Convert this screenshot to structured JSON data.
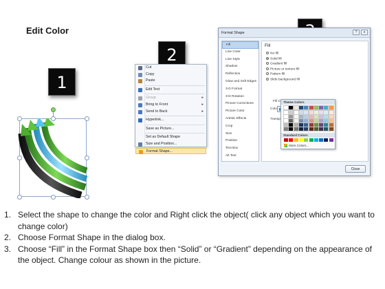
{
  "title": "Edit Color",
  "steps_badges": [
    "1",
    "2",
    "3"
  ],
  "context_menu": {
    "items": [
      {
        "label": "Cut",
        "icon": "scissors-icon",
        "color": "#5b6b86",
        "underline": "t",
        "disabled": false
      },
      {
        "label": "Copy",
        "icon": "copy-icon",
        "color": "#6f8bb3",
        "disabled": false
      },
      {
        "label": "Paste",
        "icon": "paste-icon",
        "color": "#b5853a",
        "disabled": false
      },
      {
        "sep": true
      },
      {
        "label": "Edit Text",
        "icon": "edit-text-icon",
        "color": "#3d6fb5",
        "disabled": false
      },
      {
        "sep": true
      },
      {
        "label": "Group",
        "icon": "group-icon",
        "color": "#9aa3b0",
        "disabled": true,
        "submenu": true
      },
      {
        "label": "Bring to Front",
        "icon": "bring-front-icon",
        "color": "#4b79c0",
        "disabled": false,
        "submenu": true
      },
      {
        "label": "Send to Back",
        "icon": "send-back-icon",
        "color": "#4b79c0",
        "disabled": false,
        "submenu": true
      },
      {
        "sep": true
      },
      {
        "label": "Hyperlink...",
        "icon": "hyperlink-icon",
        "color": "#2f6bb8",
        "disabled": false
      },
      {
        "sep": true
      },
      {
        "label": "Save as Picture...",
        "icon": "",
        "color": "",
        "disabled": false
      },
      {
        "sep": true
      },
      {
        "label": "Set as Default Shape",
        "icon": "",
        "color": "",
        "disabled": false
      },
      {
        "label": "Size and Position...",
        "icon": "size-position-icon",
        "color": "#5f7db0",
        "disabled": false
      },
      {
        "label": "Format Shape...",
        "icon": "format-shape-icon",
        "color": "#e3a21a",
        "disabled": false,
        "highlighted": true
      }
    ]
  },
  "dialog": {
    "title": "Format Shape",
    "controls": {
      "help": "?",
      "close": "x"
    },
    "categories": [
      "Fill",
      "Line Color",
      "Line Style",
      "Shadow",
      "Reflection",
      "Glow and Soft Edges",
      "3-D Format",
      "3-D Rotation",
      "Picture Corrections",
      "Picture Color",
      "Artistic Effects",
      "Crop",
      "Size",
      "Position",
      "Text Box",
      "Alt Text"
    ],
    "selected_category": "Fill",
    "panel_heading": "Fill",
    "fill_options": [
      {
        "label": "No fill",
        "checked": false
      },
      {
        "label": "Solid fill",
        "checked": true
      },
      {
        "label": "Gradient fill",
        "checked": false
      },
      {
        "label": "Picture or texture fill",
        "checked": false
      },
      {
        "label": "Pattern fill",
        "checked": false
      },
      {
        "label": "Slide background fill",
        "checked": false
      }
    ],
    "fill_color_label": "Fill Color",
    "color_label": "Color:",
    "transparency_label": "Transpa",
    "current_color": "#2e8fcb",
    "close_button": "Close"
  },
  "palette": {
    "theme_colors_label": "Theme Colors",
    "standard_colors_label": "Standard Colors",
    "more_colors_label": "More Colors...",
    "theme_top": [
      "#ffffff",
      "#000000",
      "#eeece1",
      "#1f497d",
      "#4f81bd",
      "#c0504d",
      "#9bbb59",
      "#8064a2",
      "#4bacc6",
      "#f79646"
    ],
    "standard": [
      "#c00000",
      "#ff0000",
      "#ffc000",
      "#ffff00",
      "#92d050",
      "#00b050",
      "#00b0f0",
      "#0070c0",
      "#002060",
      "#7030a0"
    ]
  },
  "instructions": [
    {
      "num": "1.",
      "text": "Select the shape to change the color and Right click the object( click any object which you want to change color)"
    },
    {
      "num": "2.",
      "text": "Choose Format Shape in the dialog box."
    },
    {
      "num": "3.",
      "text": "Choose “Fill” in the Format Shape box then “Solid” or “Gradient” depending on the appearance of the object. Change colour as shown in the picture."
    }
  ]
}
